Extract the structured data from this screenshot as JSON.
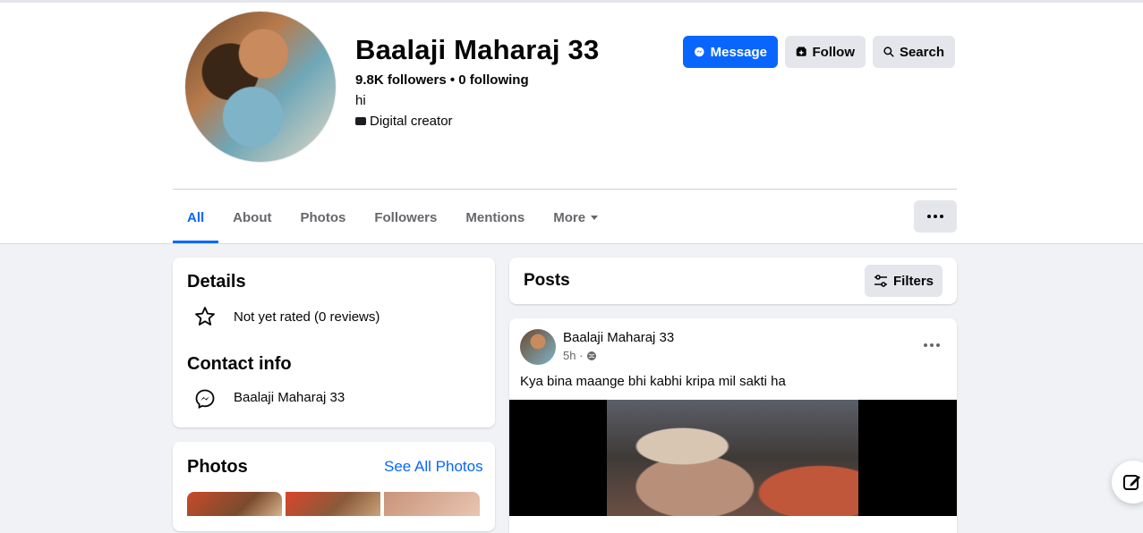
{
  "profile": {
    "name": "Baalaji Maharaj 33",
    "stats": "9.8K followers • 0 following",
    "bio": "hi",
    "category": "Digital creator"
  },
  "actions": {
    "message": "Message",
    "follow": "Follow",
    "search": "Search"
  },
  "tabs": [
    {
      "label": "All"
    },
    {
      "label": "About"
    },
    {
      "label": "Photos"
    },
    {
      "label": "Followers"
    },
    {
      "label": "Mentions"
    },
    {
      "label": "More"
    }
  ],
  "details": {
    "title": "Details",
    "rating": "Not yet rated (0 reviews)"
  },
  "contact": {
    "title": "Contact info",
    "messenger": "Baalaji Maharaj 33"
  },
  "photos": {
    "title": "Photos",
    "see_all": "See All Photos"
  },
  "posts": {
    "title": "Posts",
    "filters": "Filters"
  },
  "post": {
    "author": "Baalaji Maharaj 33",
    "time": "5h ·",
    "text": "Kya bina maange bhi kabhi kripa mil sakti ha"
  },
  "colors": {
    "accent": "#0866ff",
    "page_bg": "#f0f2f5",
    "button_gray": "#e4e6eb"
  },
  "icons": [
    "messenger-icon",
    "follow-icon",
    "search-icon",
    "star-icon",
    "messenger-outline-icon",
    "filter-icon",
    "globe-icon",
    "more-dots-icon",
    "edit-icon"
  ]
}
